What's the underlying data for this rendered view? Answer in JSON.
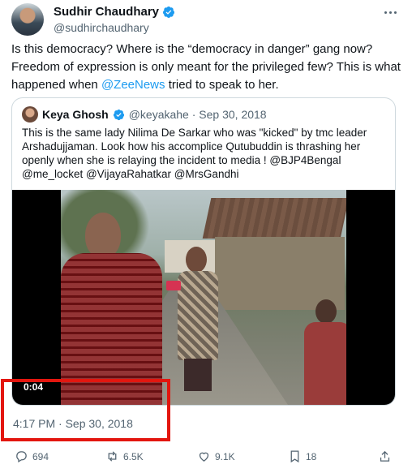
{
  "post": {
    "author_name": "Sudhir Chaudhary",
    "author_handle": "@sudhirchaudhary",
    "text_before": "Is this democracy? Where is the “democracy in danger” gang now? Freedom of expression is only meant for the privileged few? This is what happened when ",
    "mention": "@ZeeNews",
    "text_after": " tried to speak to her.",
    "timestamp": "4:17 PM · Sep 30, 2018"
  },
  "quote": {
    "author_name": "Keya Ghosh",
    "meta": "@keyakahe · Sep 30, 2018",
    "text": "This is the same lady Nilima De Sarkar who was \"kicked\" by tmc leader Arshadujjaman. Look how his accomplice Qutubuddin is thrashing her openly when she is relaying the incident to media ! @BJP4Bengal @me_locket @VijayaRahatkar @MrsGandhi",
    "video_time": "0:04"
  },
  "actions": {
    "replies": "694",
    "reposts": "6.5K",
    "likes": "9.1K",
    "bookmarks": "18"
  },
  "colors": {
    "accent": "#1d9bf0",
    "highlight": "#e3160f",
    "muted": "#536471"
  }
}
